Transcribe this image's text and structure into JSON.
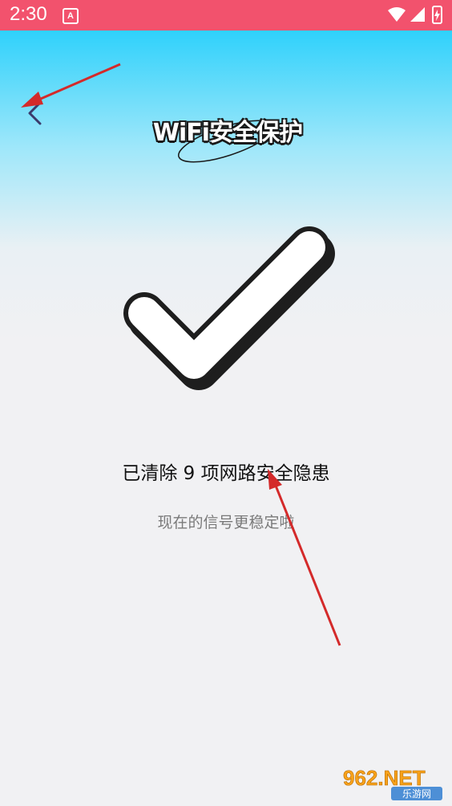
{
  "status_bar": {
    "time": "2:30",
    "app_badge": "A",
    "icons": [
      "wifi-icon",
      "signal-icon",
      "battery-charging-icon"
    ]
  },
  "header": {
    "back_icon": "chevron-left-icon",
    "title": "WiFi安全保护"
  },
  "result": {
    "icon": "checkmark-icon",
    "headline": "已清除 9 项网路安全隐患",
    "subtext": "现在的信号更稳定啦"
  },
  "watermark": {
    "logo": "962.NET",
    "caption": "乐游网"
  },
  "colors": {
    "status_bar": "#f2526d",
    "header_gradient_top": "#2fd1fb",
    "background": "#f1f1f3",
    "annotation_arrow": "#d42a2a"
  }
}
